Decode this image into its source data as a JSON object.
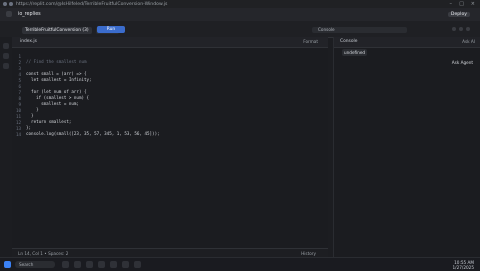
{
  "browser": {
    "url": "https://replit.com/@IsHilfeled/TerribleFruitfulConversion-Window.js",
    "title": "index.js - TerribleFruitfulConversion (3) - Replit"
  },
  "topbar": {
    "project_name": "io_replies",
    "sign_in_label": "Deploy"
  },
  "toolbar": {
    "tabs": [
      {
        "label": "TerribleFruitfulConversion (3)"
      },
      {
        "label": "index.js"
      }
    ],
    "run_label": "Run",
    "search_placeholder": "Console"
  },
  "editor": {
    "file_label": "index.js",
    "right_meta": "Format",
    "lines": [
      {
        "n": "1",
        "text": "// Find the smallest num"
      },
      {
        "n": "2",
        "text": ""
      },
      {
        "n": "3",
        "text": "const small = (arr) => {"
      },
      {
        "n": "4",
        "text": "  let smallest = Infinity;"
      },
      {
        "n": "5",
        "text": ""
      },
      {
        "n": "6",
        "text": "  for (let num of arr) {"
      },
      {
        "n": "7",
        "text": "    if (smallest > num) {"
      },
      {
        "n": "8",
        "text": "      smallest = num;"
      },
      {
        "n": "9",
        "text": "    }"
      },
      {
        "n": "10",
        "text": "  }"
      },
      {
        "n": "11",
        "text": "  return smallest;"
      },
      {
        "n": "12",
        "text": "};"
      },
      {
        "n": "13",
        "text": "console.log(small([23, 35, 57, 345, 1, 53, 56, 45]));"
      },
      {
        "n": "14",
        "text": ""
      }
    ]
  },
  "status": {
    "left": "Ln 14, Col 1 • Spaces: 2",
    "right": "History"
  },
  "rightpanel": {
    "title": "Console",
    "right": "Ask AI",
    "output": "undefined",
    "agent": "Ask Agent"
  },
  "taskbar": {
    "search_placeholder": "Search",
    "time": "10:55 AM",
    "date": "1/27/2025"
  }
}
